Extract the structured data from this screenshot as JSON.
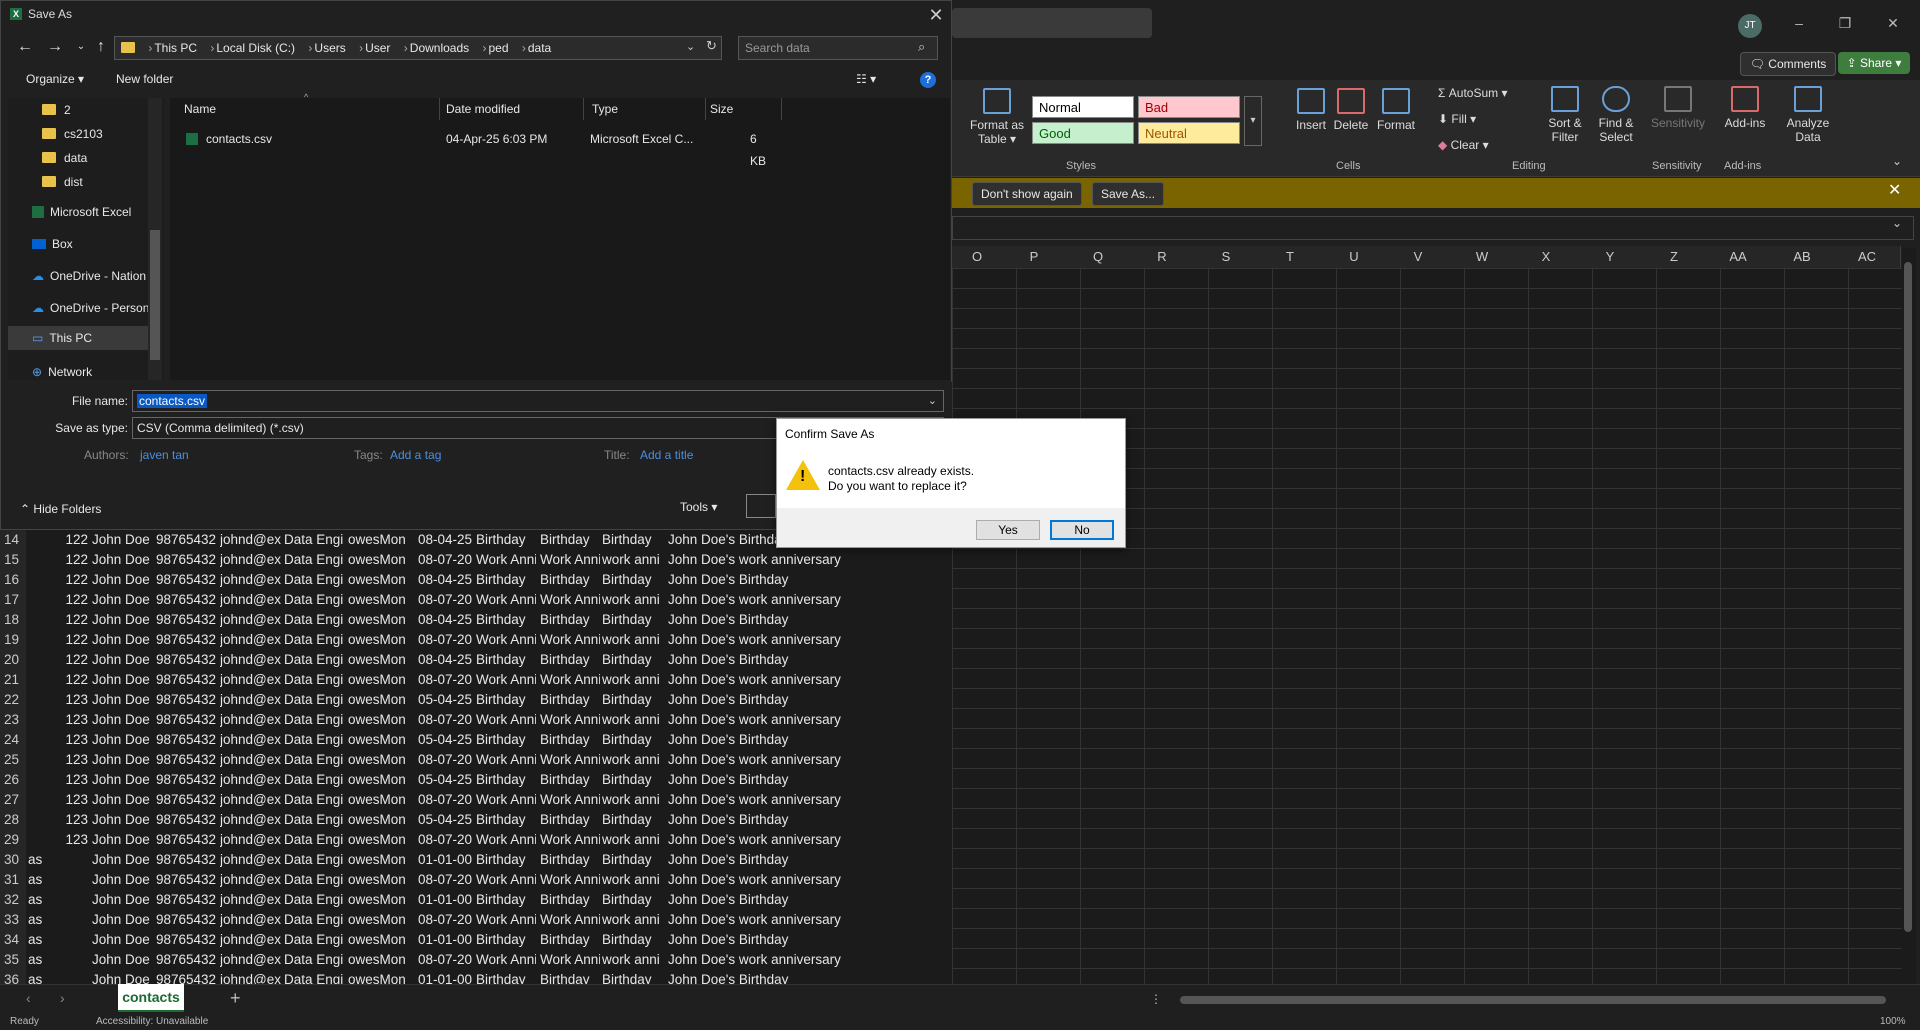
{
  "excel": {
    "avatar": "JT",
    "comments_label": "Comments",
    "share_label": "Share",
    "ribbon": {
      "format_as_table": "Format as Table",
      "styles": {
        "normal": "Normal",
        "bad": "Bad",
        "good": "Good",
        "neutral": "Neutral"
      },
      "insert": "Insert",
      "delete": "Delete",
      "format": "Format",
      "autosum": "AutoSum",
      "fill": "Fill",
      "clear": "Clear",
      "sort_filter": "Sort & Filter",
      "find_select": "Find & Select",
      "sensitivity": "Sensitivity",
      "addins": "Add-ins",
      "analyze": "Analyze Data",
      "groups": {
        "styles": "Styles",
        "cells": "Cells",
        "editing": "Editing",
        "sensitivity": "Sensitivity",
        "addins": "Add-ins"
      }
    },
    "message_bar": {
      "dont_show": "Don't show again",
      "save_as": "Save As..."
    },
    "columns": [
      "O",
      "P",
      "Q",
      "R",
      "S",
      "T",
      "U",
      "V",
      "W",
      "X",
      "Y",
      "Z",
      "AA",
      "AB",
      "AC"
    ],
    "rows": [
      {
        "n": "14",
        "a": "122",
        "b": "John Doe",
        "c": "98765432",
        "d": "johnd@ex",
        "e": "Data Engi",
        "f": "owesMon",
        "g": "08-04-25",
        "h": "Birthday",
        "i": "Birthday",
        "j": "Birthday",
        "k": "John Doe's Birthday"
      },
      {
        "n": "15",
        "a": "122",
        "b": "John Doe",
        "c": "98765432",
        "d": "johnd@ex",
        "e": "Data Engi",
        "f": "owesMon",
        "g": "08-07-20",
        "h": "Work Anni",
        "i": "Work Anni",
        "j": "work anni",
        "k": "John Doe's work anniversary"
      },
      {
        "n": "16",
        "a": "122",
        "b": "John Doe",
        "c": "98765432",
        "d": "johnd@ex",
        "e": "Data Engi",
        "f": "owesMon",
        "g": "08-04-25",
        "h": "Birthday",
        "i": "Birthday",
        "j": "Birthday",
        "k": "John Doe's Birthday"
      },
      {
        "n": "17",
        "a": "122",
        "b": "John Doe",
        "c": "98765432",
        "d": "johnd@ex",
        "e": "Data Engi",
        "f": "owesMon",
        "g": "08-07-20",
        "h": "Work Anni",
        "i": "Work Anni",
        "j": "work anni",
        "k": "John Doe's work anniversary"
      },
      {
        "n": "18",
        "a": "122",
        "b": "John Doe",
        "c": "98765432",
        "d": "johnd@ex",
        "e": "Data Engi",
        "f": "owesMon",
        "g": "08-04-25",
        "h": "Birthday",
        "i": "Birthday",
        "j": "Birthday",
        "k": "John Doe's Birthday"
      },
      {
        "n": "19",
        "a": "122",
        "b": "John Doe",
        "c": "98765432",
        "d": "johnd@ex",
        "e": "Data Engi",
        "f": "owesMon",
        "g": "08-07-20",
        "h": "Work Anni",
        "i": "Work Anni",
        "j": "work anni",
        "k": "John Doe's work anniversary"
      },
      {
        "n": "20",
        "a": "122",
        "b": "John Doe",
        "c": "98765432",
        "d": "johnd@ex",
        "e": "Data Engi",
        "f": "owesMon",
        "g": "08-04-25",
        "h": "Birthday",
        "i": "Birthday",
        "j": "Birthday",
        "k": "John Doe's Birthday"
      },
      {
        "n": "21",
        "a": "122",
        "b": "John Doe",
        "c": "98765432",
        "d": "johnd@ex",
        "e": "Data Engi",
        "f": "owesMon",
        "g": "08-07-20",
        "h": "Work Anni",
        "i": "Work Anni",
        "j": "work anni",
        "k": "John Doe's work anniversary"
      },
      {
        "n": "22",
        "a": "123",
        "b": "John Doe",
        "c": "98765432",
        "d": "johnd@ex",
        "e": "Data Engi",
        "f": "owesMon",
        "g": "05-04-25",
        "h": "Birthday",
        "i": "Birthday",
        "j": "Birthday",
        "k": "John Doe's Birthday"
      },
      {
        "n": "23",
        "a": "123",
        "b": "John Doe",
        "c": "98765432",
        "d": "johnd@ex",
        "e": "Data Engi",
        "f": "owesMon",
        "g": "08-07-20",
        "h": "Work Anni",
        "i": "Work Anni",
        "j": "work anni",
        "k": "John Doe's work anniversary"
      },
      {
        "n": "24",
        "a": "123",
        "b": "John Doe",
        "c": "98765432",
        "d": "johnd@ex",
        "e": "Data Engi",
        "f": "owesMon",
        "g": "05-04-25",
        "h": "Birthday",
        "i": "Birthday",
        "j": "Birthday",
        "k": "John Doe's Birthday"
      },
      {
        "n": "25",
        "a": "123",
        "b": "John Doe",
        "c": "98765432",
        "d": "johnd@ex",
        "e": "Data Engi",
        "f": "owesMon",
        "g": "08-07-20",
        "h": "Work Anni",
        "i": "Work Anni",
        "j": "work anni",
        "k": "John Doe's work anniversary"
      },
      {
        "n": "26",
        "a": "123",
        "b": "John Doe",
        "c": "98765432",
        "d": "johnd@ex",
        "e": "Data Engi",
        "f": "owesMon",
        "g": "05-04-25",
        "h": "Birthday",
        "i": "Birthday",
        "j": "Birthday",
        "k": "John Doe's Birthday"
      },
      {
        "n": "27",
        "a": "123",
        "b": "John Doe",
        "c": "98765432",
        "d": "johnd@ex",
        "e": "Data Engi",
        "f": "owesMon",
        "g": "08-07-20",
        "h": "Work Anni",
        "i": "Work Anni",
        "j": "work anni",
        "k": "John Doe's work anniversary"
      },
      {
        "n": "28",
        "a": "123",
        "b": "John Doe",
        "c": "98765432",
        "d": "johnd@ex",
        "e": "Data Engi",
        "f": "owesMon",
        "g": "05-04-25",
        "h": "Birthday",
        "i": "Birthday",
        "j": "Birthday",
        "k": "John Doe's Birthday"
      },
      {
        "n": "29",
        "a": "123",
        "b": "John Doe",
        "c": "98765432",
        "d": "johnd@ex",
        "e": "Data Engi",
        "f": "owesMon",
        "g": "08-07-20",
        "h": "Work Anni",
        "i": "Work Anni",
        "j": "work anni",
        "k": "John Doe's work anniversary"
      },
      {
        "n": "30",
        "a": "as",
        "b": "John Doe",
        "c": "98765432",
        "d": "johnd@ex",
        "e": "Data Engi",
        "f": "owesMon",
        "g": "01-01-00",
        "h": "Birthday",
        "i": "Birthday",
        "j": "Birthday",
        "k": "John Doe's Birthday"
      },
      {
        "n": "31",
        "a": "as",
        "b": "John Doe",
        "c": "98765432",
        "d": "johnd@ex",
        "e": "Data Engi",
        "f": "owesMon",
        "g": "08-07-20",
        "h": "Work Anni",
        "i": "Work Anni",
        "j": "work anni",
        "k": "John Doe's work anniversary"
      },
      {
        "n": "32",
        "a": "as",
        "b": "John Doe",
        "c": "98765432",
        "d": "johnd@ex",
        "e": "Data Engi",
        "f": "owesMon",
        "g": "01-01-00",
        "h": "Birthday",
        "i": "Birthday",
        "j": "Birthday",
        "k": "John Doe's Birthday"
      },
      {
        "n": "33",
        "a": "as",
        "b": "John Doe",
        "c": "98765432",
        "d": "johnd@ex",
        "e": "Data Engi",
        "f": "owesMon",
        "g": "08-07-20",
        "h": "Work Anni",
        "i": "Work Anni",
        "j": "work anni",
        "k": "John Doe's work anniversary"
      },
      {
        "n": "34",
        "a": "as",
        "b": "John Doe",
        "c": "98765432",
        "d": "johnd@ex",
        "e": "Data Engi",
        "f": "owesMon",
        "g": "01-01-00",
        "h": "Birthday",
        "i": "Birthday",
        "j": "Birthday",
        "k": "John Doe's Birthday"
      },
      {
        "n": "35",
        "a": "as",
        "b": "John Doe",
        "c": "98765432",
        "d": "johnd@ex",
        "e": "Data Engi",
        "f": "owesMon",
        "g": "08-07-20",
        "h": "Work Anni",
        "i": "Work Anni",
        "j": "work anni",
        "k": "John Doe's work anniversary"
      },
      {
        "n": "36",
        "a": "as",
        "b": "John Doe",
        "c": "98765432",
        "d": "johnd@ex",
        "e": "Data Engi",
        "f": "owesMon",
        "g": "01-01-00",
        "h": "Birthday",
        "i": "Birthday",
        "j": "Birthday",
        "k": "John Doe's Birthday"
      }
    ],
    "sheet_tab": "contacts",
    "status": {
      "ready": "Ready",
      "accessibility": "Accessibility: Unavailable",
      "zoom": "100%"
    }
  },
  "save_dialog": {
    "title": "Save As",
    "breadcrumb": [
      "This PC",
      "Local Disk (C:)",
      "Users",
      "User",
      "Downloads",
      "ped",
      "data"
    ],
    "search_placeholder": "Search data",
    "organize": "Organize",
    "new_folder": "New folder",
    "nav_items": [
      {
        "label": "2",
        "icon": "folder-icon"
      },
      {
        "label": "cs2103",
        "icon": "folder-icon"
      },
      {
        "label": "data",
        "icon": "folder-icon"
      },
      {
        "label": "dist",
        "icon": "folder-icon"
      },
      {
        "label": "Microsoft Excel",
        "icon": "excel-icon"
      },
      {
        "label": "Box",
        "icon": "box-icon"
      },
      {
        "label": "OneDrive - Nation",
        "icon": "cloud-icon"
      },
      {
        "label": "OneDrive - Person",
        "icon": "cloud-icon"
      },
      {
        "label": "This PC",
        "icon": "pc-icon"
      },
      {
        "label": "Network",
        "icon": "network-icon"
      }
    ],
    "columns": {
      "name": "Name",
      "date": "Date modified",
      "type": "Type",
      "size": "Size"
    },
    "files": [
      {
        "name": "contacts.csv",
        "date": "04-Apr-25 6:03 PM",
        "type": "Microsoft Excel C...",
        "size": "6 KB"
      }
    ],
    "file_name_label": "File name:",
    "file_name_value": "contacts.csv",
    "save_type_label": "Save as type:",
    "save_type_value": "CSV (Comma delimited) (*.csv)",
    "authors_label": "Authors:",
    "authors_value": "javen tan",
    "tags_label": "Tags:",
    "tags_value": "Add a tag",
    "title_label": "Title:",
    "title_value": "Add a title",
    "hide_folders": "Hide Folders",
    "tools": "Tools"
  },
  "confirm_dialog": {
    "title": "Confirm Save As",
    "line1": "contacts.csv already exists.",
    "line2": "Do you want to replace it?",
    "yes": "Yes",
    "no": "No"
  }
}
